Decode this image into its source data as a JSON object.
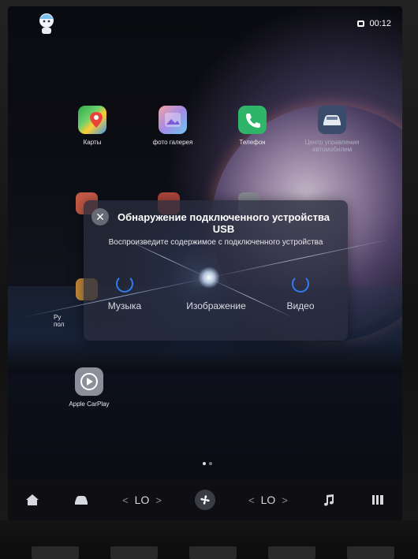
{
  "status": {
    "time": "00:12"
  },
  "apps": {
    "maps": "Карты",
    "gallery": "фото галерея",
    "phone": "Телефон",
    "car_center_line1": "Центр управления",
    "car_center_line2": "автомобилем",
    "partial_left_line1": "Ру",
    "partial_left_line2": "пол",
    "carplay": "Apple CarPlay"
  },
  "dialog": {
    "title": "Обнаружение подключенного устройства USB",
    "subtitle": "Воспроизведите содержимое с подключенного устройства",
    "options": [
      {
        "label": "Музыка"
      },
      {
        "label": "Изображение"
      },
      {
        "label": "Видео"
      }
    ]
  },
  "bar": {
    "temp_left": "LO",
    "temp_right": "LO"
  }
}
